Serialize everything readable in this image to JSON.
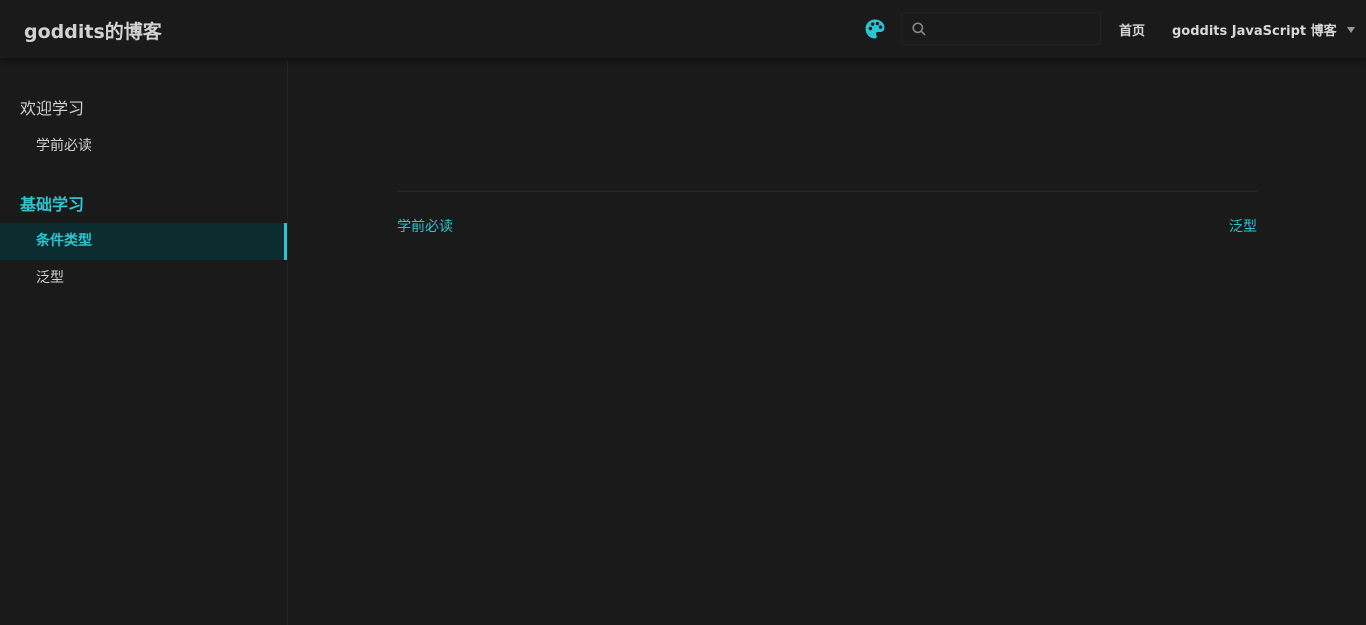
{
  "navbar": {
    "site_name": "goddits的博客",
    "search": {
      "value": "",
      "placeholder": ""
    },
    "links": {
      "home": "首页",
      "dropdown": "goddits JavaScript 博客"
    }
  },
  "sidebar": {
    "groups": [
      {
        "title": "欢迎学习",
        "items": [
          {
            "label": "学前必读",
            "active": false
          }
        ]
      },
      {
        "title": "基础学习",
        "items": [
          {
            "label": "条件类型",
            "active": true
          },
          {
            "label": "泛型",
            "active": false
          }
        ]
      }
    ]
  },
  "page_nav": {
    "prev": "学前必读",
    "next": "泛型"
  },
  "colors": {
    "accent": "#2cc4d0",
    "background": "#1a1a1a",
    "active_bg": "#0c2d30"
  },
  "icons": {
    "palette": "palette-icon",
    "search": "search-icon",
    "caret": "caret-down-icon"
  }
}
